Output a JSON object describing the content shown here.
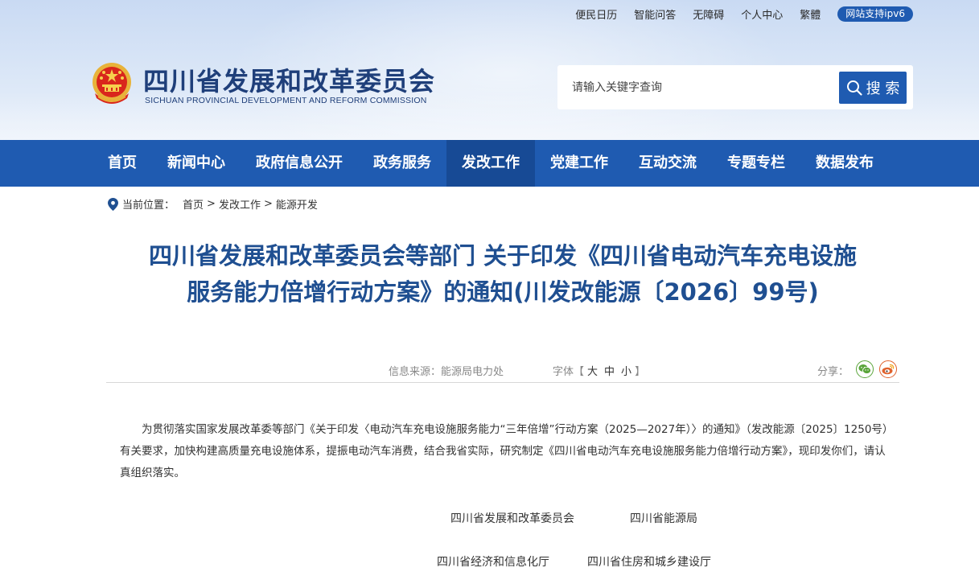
{
  "top_links": [
    "便民日历",
    "智能问答",
    "无障碍",
    "个人中心",
    "繁體"
  ],
  "ipv6_badge": "网站支持ipv6",
  "site": {
    "title": "四川省发展和改革委员会",
    "title_en": "SICHUAN PROVINCIAL DEVELOPMENT AND REFORM COMMISSION"
  },
  "search": {
    "placeholder": "请输入关键字查询",
    "button_label": "搜 索"
  },
  "nav": {
    "items": [
      "首页",
      "新闻中心",
      "政府信息公开",
      "政务服务",
      "发改工作",
      "党建工作",
      "互动交流",
      "专题专栏",
      "数据发布"
    ],
    "active": "发改工作"
  },
  "breadcrumb": {
    "label": "当前位置：",
    "items": [
      "首页",
      "发改工作",
      "能源开发"
    ],
    "separator": ">"
  },
  "article": {
    "title": "四川省发展和改革委员会等部门 关于印发《四川省电动汽车充电设施服务能力倍增行动方案》的通知(川发改能源〔2026〕99号)",
    "source": "信息来源：能源局电力处",
    "font_label": "字体【",
    "font_large": "大",
    "font_medium": "中",
    "font_small": "小",
    "font_close": "】",
    "share_label": "分享：",
    "body": "为贯彻落实国家发展改革委等部门《关于印发〈电动汽车充电设施服务能力“三年倍增”行动方案（2025—2027年）〉的通知》（发改能源〔2025〕1250号）有关要求，加快构建高质量充电设施体系，提振电动汽车消费，结合我省实际，研究制定《四川省电动汽车充电设施服务能力倍增行动方案》，现印发你们，请认真组织落实。",
    "signers": [
      "四川省发展和改革委员会",
      "四川省能源局",
      "四川省经济和信息化厅",
      "四川省住房和城乡建设厅"
    ]
  },
  "colors": {
    "nav_bg": "#1f5bb1",
    "nav_active": "#174a95",
    "title_blue": "#1f4f91"
  }
}
